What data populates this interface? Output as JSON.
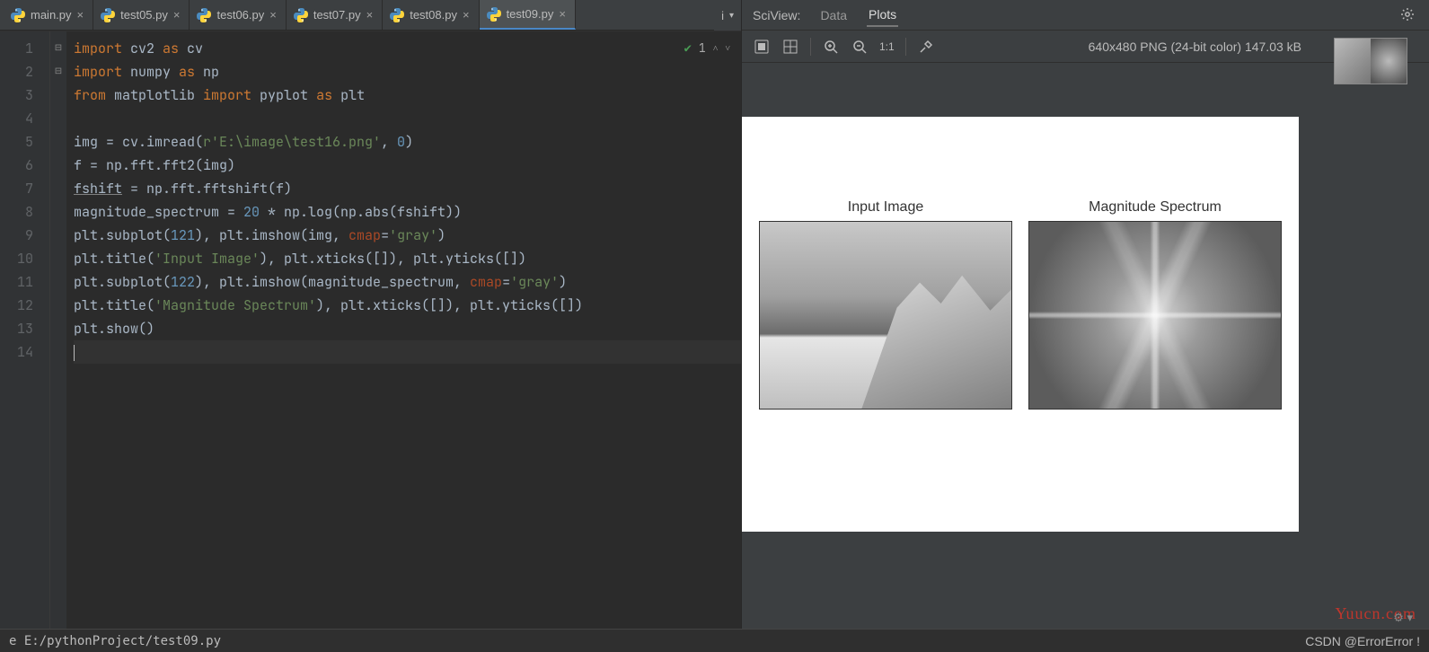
{
  "tabs": [
    {
      "label": "main.py"
    },
    {
      "label": "test05.py"
    },
    {
      "label": "test06.py"
    },
    {
      "label": "test07.py"
    },
    {
      "label": "test08.py"
    },
    {
      "label": "test09.py"
    }
  ],
  "tabs_more": "i",
  "active_tab": "test09.py",
  "gutter": [
    "1",
    "2",
    "3",
    "4",
    "5",
    "6",
    "7",
    "8",
    "9",
    "10",
    "11",
    "12",
    "13",
    "14"
  ],
  "code": {
    "l1": {
      "a": "import",
      "b": " cv2 ",
      "c": "as",
      "d": " cv"
    },
    "l2": {
      "a": "import",
      "b": " numpy ",
      "c": "as",
      "d": " np"
    },
    "l3": {
      "a": "from",
      "b": " matplotlib ",
      "c": "import",
      "d": " pyplot ",
      "e": "as",
      "f": " plt"
    },
    "l5": {
      "a": "img = cv.imread(",
      "b": "r'E:\\image\\test16.png'",
      "c": ", ",
      "d": "0",
      "e": ")"
    },
    "l6": "f = np.fft.fft2(img)",
    "l7": {
      "a": "fshift",
      "b": " = np.fft.fftshift(f)"
    },
    "l8": {
      "a": "magnitude_spectrum = ",
      "b": "20",
      "c": " * np.log(np.abs(fshift))"
    },
    "l9": {
      "a": "plt.subplot(",
      "b": "121",
      "c": "), plt.imshow(img, ",
      "d": "cmap",
      "e": "=",
      "f": "'gray'",
      "g": ")"
    },
    "l10": {
      "a": "plt.title(",
      "b": "'Input Image'",
      "c": "), plt.xticks([]), plt.yticks([])"
    },
    "l11": {
      "a": "plt.subplot(",
      "b": "122",
      "c": "), plt.imshow(magnitude_spectrum, ",
      "d": "cmap",
      "e": "=",
      "f": "'gray'",
      "g": ")"
    },
    "l12": {
      "a": "plt.title(",
      "b": "'Magnitude Spectrum'",
      "c": "), plt.xticks([]), plt.yticks([])"
    },
    "l13": "plt.show()"
  },
  "inspection": {
    "count": "1"
  },
  "sciview": {
    "title": "SciView:",
    "tabs": [
      "Data",
      "Plots"
    ],
    "info": "640x480 PNG (24-bit color) 147.03 kB",
    "ratio": "1:1"
  },
  "plots": {
    "left_title": "Input Image",
    "right_title": "Magnitude Spectrum"
  },
  "status": {
    "path": "e E:/pythonProject/test09.py",
    "right": "CSDN @ErrorError !"
  },
  "watermark": "Yuucn.com"
}
